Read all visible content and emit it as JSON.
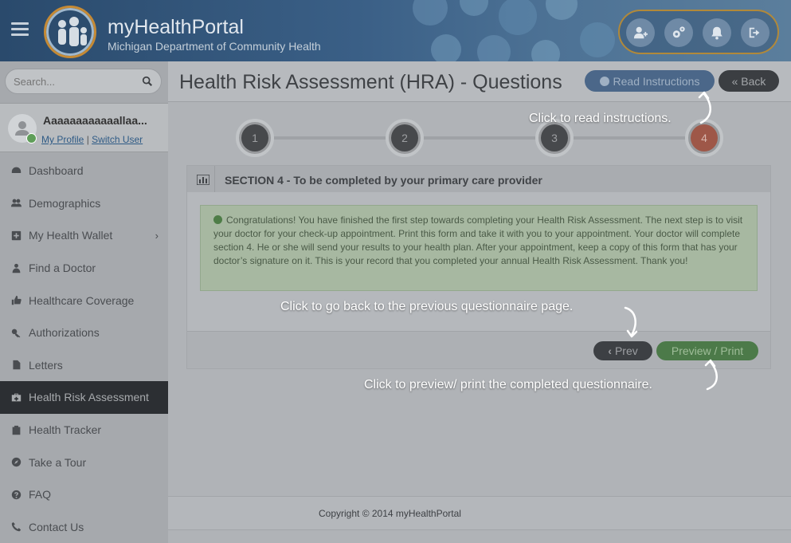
{
  "header": {
    "brand_title": "myHealthPortal",
    "brand_subtitle": "Michigan Department of Community Health",
    "actions": [
      "add-user-icon",
      "settings-icon",
      "bell-icon",
      "logout-icon"
    ]
  },
  "sidebar": {
    "search_placeholder": "Search...",
    "profile": {
      "name": "Aaaaaaaaaaaallaa...",
      "my_profile": "My Profile",
      "separator": "|",
      "switch_user": "Switch User"
    },
    "items": [
      {
        "label": "Dashboard",
        "icon": "dashboard-icon"
      },
      {
        "label": "Demographics",
        "icon": "users-icon"
      },
      {
        "label": "My Health Wallet",
        "icon": "plus-square-icon",
        "chevron": "›"
      },
      {
        "label": "Find a Doctor",
        "icon": "doctor-icon"
      },
      {
        "label": "Healthcare Coverage",
        "icon": "thumbs-up-icon"
      },
      {
        "label": "Authorizations",
        "icon": "key-icon"
      },
      {
        "label": "Letters",
        "icon": "file-icon"
      },
      {
        "label": "Health Risk Assessment",
        "icon": "medkit-icon",
        "active": true
      },
      {
        "label": "Health Tracker",
        "icon": "clipboard-icon"
      },
      {
        "label": "Take a Tour",
        "icon": "compass-icon"
      },
      {
        "label": "FAQ",
        "icon": "question-icon"
      },
      {
        "label": "Contact Us",
        "icon": "phone-icon"
      }
    ]
  },
  "main": {
    "page_title": "Health Risk Assessment (HRA) - Questions",
    "read_instructions": "Read Instructions",
    "back": "« Back",
    "steps": [
      "1",
      "2",
      "3",
      "4"
    ],
    "current_step": 4,
    "section_title": "SECTION 4 - To be completed by your primary care provider",
    "alert_text": "Congratulations! You have finished the first step towards completing your Health Risk Assessment. The next step is to visit your doctor for your check-up appointment. Print this form and take it with you to your appointment. Your doctor will complete section 4. He or she will send your results to your health plan. After your appointment, keep a copy of this form that has your doctor’s signature on it. This is your record that you completed your annual Health Risk Assessment. Thank you!",
    "prev": "Prev",
    "preview_print": "Preview / Print",
    "copyright": "Copyright © 2014 myHealthPortal"
  },
  "callouts": {
    "read_instructions": "Click to read instructions.",
    "prev": "Click to go back to the previous questionnaire page.",
    "preview": "Click to preview/ print the completed questionnaire."
  }
}
